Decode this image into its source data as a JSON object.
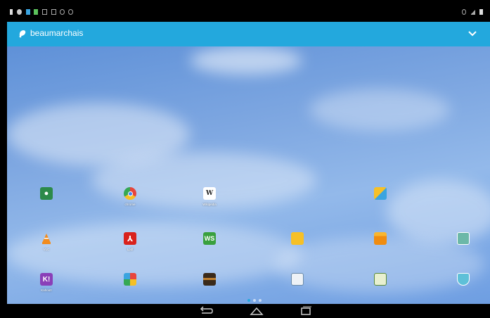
{
  "account": {
    "name": "beaumarchais"
  },
  "colors": {
    "topbar": "#23a8dd",
    "wallpaper_sky": "#6e9ee2"
  },
  "status_icons": [
    "sim-icon",
    "messaging-icon",
    "download-icon",
    "usb-icon",
    "screenshot-icon",
    "wifi-icon",
    "sync-icon",
    "sync-icon",
    "alarm-icon",
    "signal-icon",
    "battery-icon"
  ],
  "apps": [
    {
      "label": "",
      "icon": "puffin-icon"
    },
    {
      "label": "chrome",
      "icon": "chrome-icon"
    },
    {
      "label": "Wikipedia",
      "icon": "wikipedia-icon"
    },
    {
      "label": "",
      "icon": "apps-store-icon"
    },
    {
      "label": "VLC",
      "icon": "vlc-icon"
    },
    {
      "label": "Lpdf",
      "icon": "pdf-icon"
    },
    {
      "label": "",
      "icon": "ws-icon"
    },
    {
      "label": "",
      "icon": "folder-icon"
    },
    {
      "label": "",
      "icon": "file-manager-icon"
    },
    {
      "label": "",
      "icon": "app-icon"
    },
    {
      "label": "Kahoot!",
      "icon": "kahoot-icon"
    },
    {
      "label": "",
      "icon": "photo-collage-icon"
    },
    {
      "label": "",
      "icon": "video-icon"
    },
    {
      "label": "",
      "icon": "copy-icon"
    },
    {
      "label": "",
      "icon": "notes-icon"
    },
    {
      "label": "",
      "icon": "shield-icon"
    }
  ],
  "page_indicator": {
    "pages": 3,
    "current": 1
  },
  "navbar": {
    "buttons": [
      "back",
      "home",
      "recents"
    ]
  }
}
